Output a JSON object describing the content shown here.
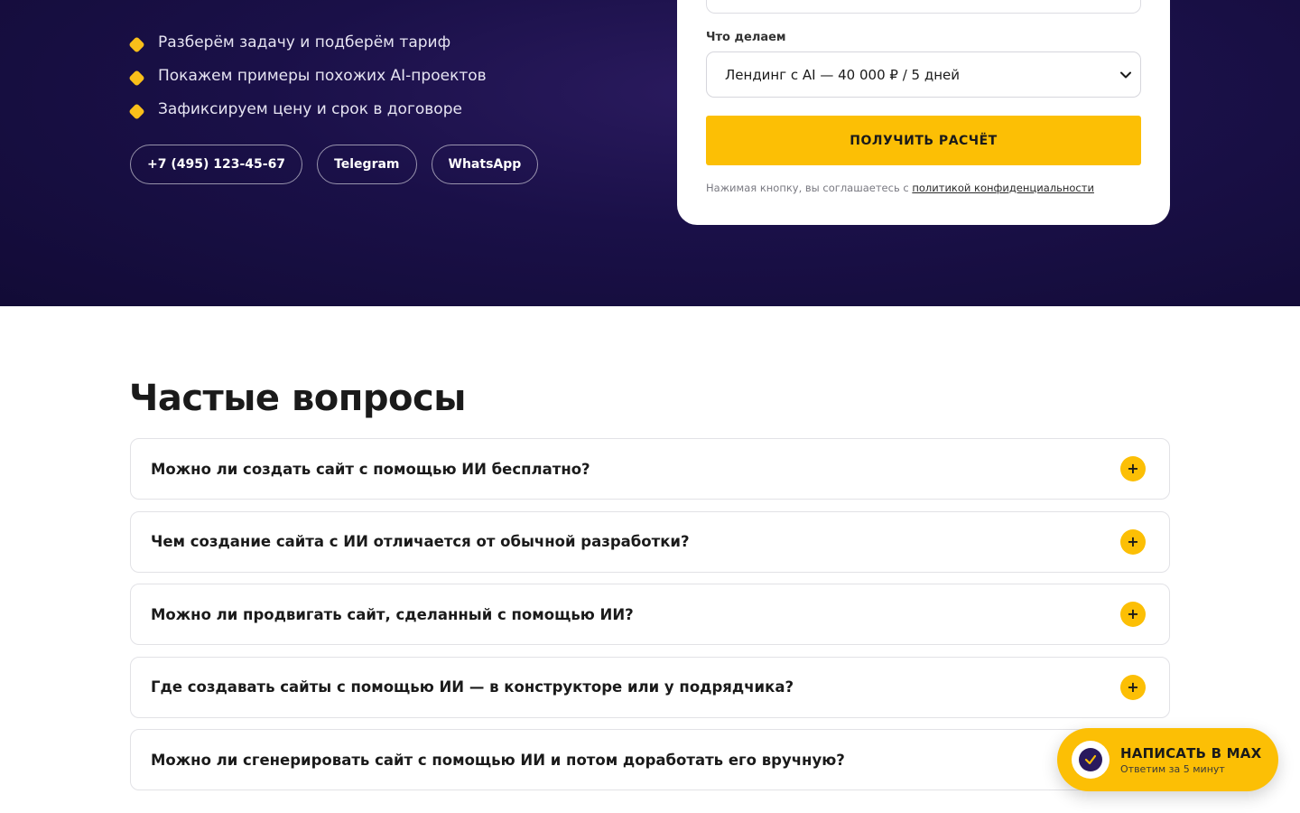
{
  "hero": {
    "bullets": [
      "Разберём задачу и подберём тариф",
      "Покажем примеры похожих AI-проектов",
      "Зафиксируем цену и срок в договоре"
    ],
    "contacts": {
      "phone": "+7 (495) 123-45-67",
      "telegram": "Telegram",
      "whatsapp": "WhatsApp"
    }
  },
  "form": {
    "field_label": "Что делаем",
    "select_value": "Лендинг с AI — 40 000 ₽ / 5 дней",
    "submit_label": "ПОЛУЧИТЬ РАСЧЁТ",
    "consent_prefix": "Нажимая кнопку, вы соглашаетесь с ",
    "consent_link": "политикой конфиденциальности"
  },
  "faq": {
    "title": "Частые вопросы",
    "items": [
      "Можно ли создать сайт с помощью ИИ бесплатно?",
      "Чем создание сайта с ИИ отличается от обычной разработки?",
      "Можно ли продвигать сайт, сделанный с помощью ИИ?",
      "Где создавать сайты с помощью ИИ — в конструкторе или у подрядчика?",
      "Можно ли сгенерировать сайт с помощью ИИ и потом доработать его вручную?"
    ]
  },
  "chat": {
    "title": "НАПИСАТЬ В MAX",
    "subtitle": "Ответим за 5 минут"
  },
  "colors": {
    "accent": "#fcbf05",
    "hero_bg": "#1a1048",
    "text": "#1a1a1a"
  }
}
